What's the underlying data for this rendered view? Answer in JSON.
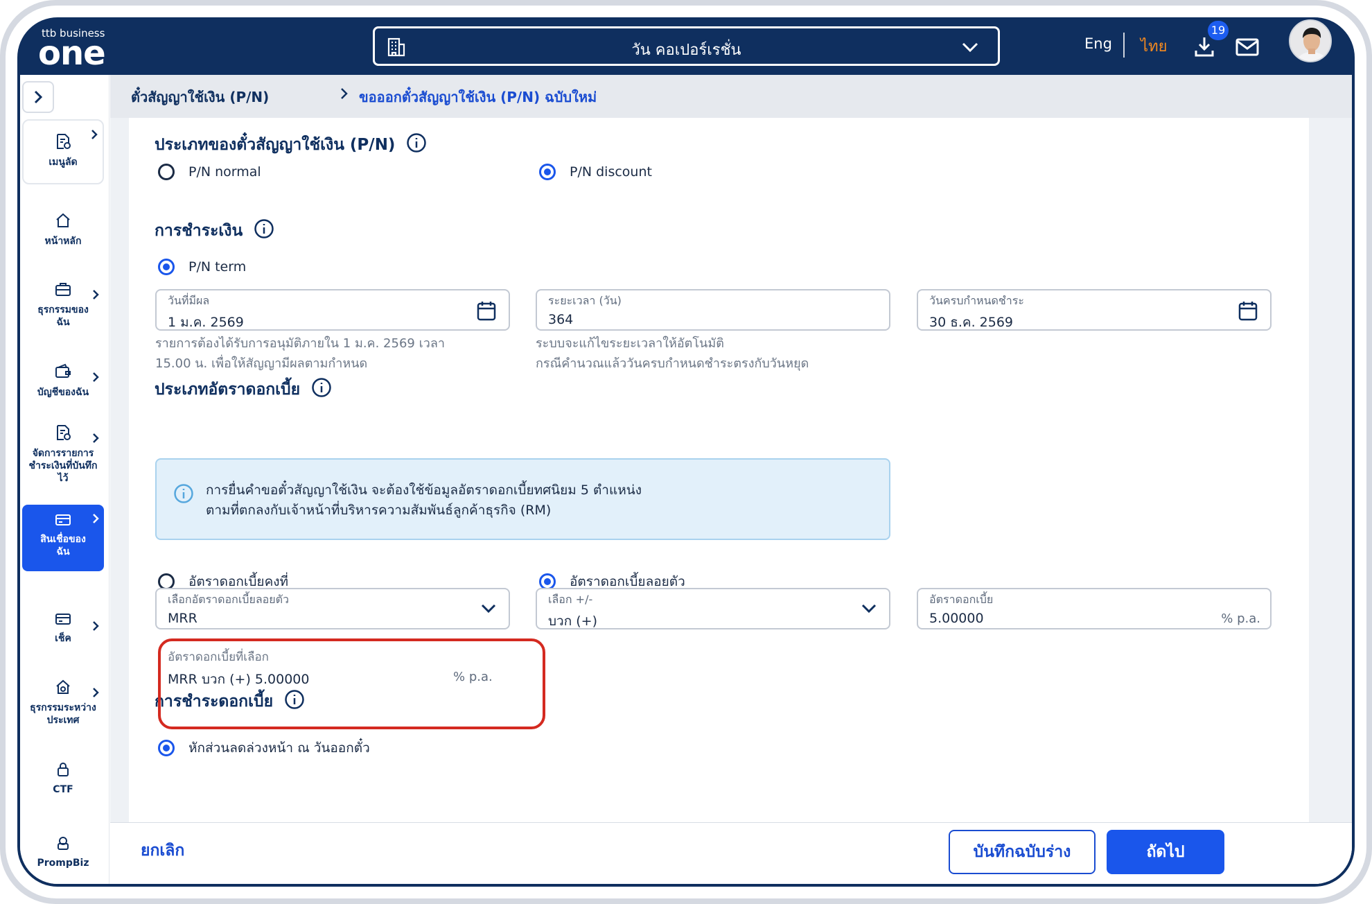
{
  "header": {
    "logo_small": "ttb business",
    "logo_big": "one",
    "company": "วัน คอเปอร์เรชั่น",
    "lang_eng": "Eng",
    "lang_thai": "ไทย",
    "download_badge": "19",
    "icons": [
      "building-icon",
      "chevron-down-icon",
      "download-icon",
      "mail-icon",
      "avatar"
    ]
  },
  "sidebar": {
    "items": [
      {
        "label": "เมนูลัด",
        "icon": "shortcut-icon"
      },
      {
        "label": "หน้าหลัก",
        "icon": "home-icon"
      },
      {
        "label": "ธุรกรรมของฉัน",
        "icon": "briefcase-icon"
      },
      {
        "label": "บัญชีของฉัน",
        "icon": "wallet-icon"
      },
      {
        "label": "จัดการรายการชำระเงินที่บันทึกไว้",
        "icon": "document-icon"
      },
      {
        "label": "สินเชื่อของฉัน",
        "icon": "card-icon",
        "active": true
      },
      {
        "label": "เช็ค",
        "icon": "cheque-icon"
      },
      {
        "label": "ธุรกรรมระหว่างประเทศ",
        "icon": "globe-house-icon"
      },
      {
        "label": "CTF",
        "icon": "lock-icon"
      },
      {
        "label": "PrompBiz",
        "icon": "prompbiz-icon"
      }
    ]
  },
  "breadcrumb": {
    "item1": "ตั๋วสัญญาใช้เงิน (P/N)",
    "item2": "ขอออกตั๋วสัญญาใช้เงิน (P/N) ฉบับใหม่"
  },
  "form": {
    "pn_type_title": "ประเภทของตั๋วสัญญาใช้เงิน (P/N)",
    "pn_normal": "P/N normal",
    "pn_discount": "P/N discount",
    "payment_title": "การชำระเงิน",
    "pn_term": "P/N term",
    "effective_date": {
      "label": "วันที่มีผล",
      "value": "1 ม.ค. 2569"
    },
    "duration": {
      "label": "ระยะเวลา (วัน)",
      "value": "364"
    },
    "due_date": {
      "label": "วันครบกำหนดชำระ",
      "value": "30 ธ.ค. 2569"
    },
    "hint_effective": [
      "รายการต้องได้รับการอนุมัติภายใน 1 ม.ค. 2569 เวลา",
      "15.00 น. เพื่อให้สัญญามีผลตามกำหนด"
    ],
    "hint_duration": [
      "ระบบจะแก้ไขระยะเวลาให้อัตโนมัติ",
      "กรณีคำนวณแล้ววันครบกำหนดชำระตรงกับวันหยุด"
    ],
    "rate_type_title": "ประเภทอัตราดอกเบี้ย",
    "info_text": [
      "การยื่นคำขอตั๋วสัญญาใช้เงิน จะต้องใช้ข้อมูลอัตราดอกเบี้ยทศนิยม 5 ตำแหน่ง",
      "ตามที่ตกลงกับเจ้าหน้าที่บริหารความสัมพันธ์ลูกค้าธุรกิจ (RM)"
    ],
    "fixed_rate": "อัตราดอกเบี้ยคงที่",
    "floating_rate": "อัตราดอกเบี้ยลอยตัว",
    "floating_select": {
      "label": "เลือกอัตราดอกเบี้ยลอยตัว",
      "value": "MRR"
    },
    "sign_select": {
      "label": "เลือก +/-",
      "value": "บวก (+)"
    },
    "rate_input": {
      "label": "อัตราดอกเบี้ย",
      "value": "5.00000",
      "unit": "% p.a."
    },
    "selected_rate": {
      "label": "อัตราดอกเบี้ยที่เลือก",
      "value": "MRR บวก (+) 5.00000",
      "unit": "% p.a."
    },
    "interest_payment_title": "การชำระดอกเบี้ย",
    "discount_upfront": "หักส่วนลดล่วงหน้า ณ วันออกตั๋ว"
  },
  "footer": {
    "cancel": "ยกเลิก",
    "save_draft": "บันทึกฉบับร่าง",
    "next": "ถัดไป"
  },
  "colors": {
    "navy": "#0f2f5f",
    "primary": "#1a56eb",
    "accent_orange": "#f58a1f",
    "highlight_red": "#d42a20"
  }
}
